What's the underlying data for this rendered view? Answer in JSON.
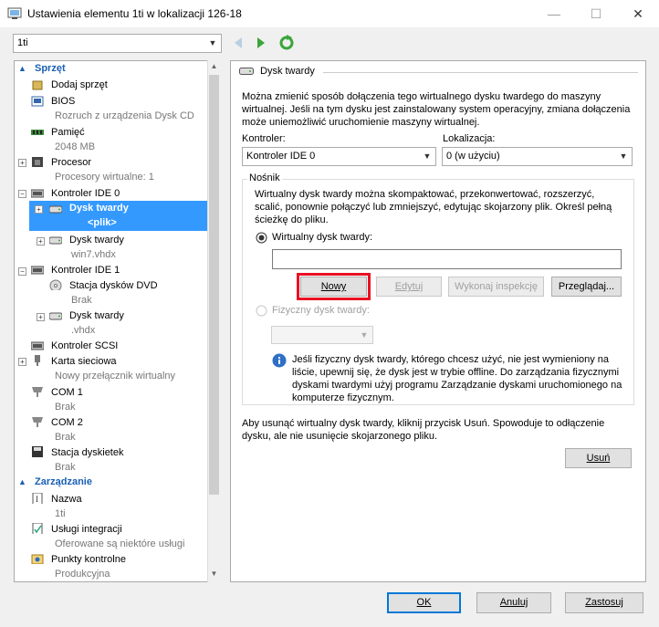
{
  "window": {
    "title": "Ustawienia elementu 1ti w lokalizacji 126-18"
  },
  "vm_selector": {
    "value": "1ti"
  },
  "tree": {
    "hardware_header": "Sprzęt",
    "add_hardware": "Dodaj sprzęt",
    "bios": "BIOS",
    "bios_sub": "Rozruch z urządzenia Dysk CD",
    "memory": "Pamięć",
    "memory_sub": "2048 MB",
    "processor": "Procesor",
    "processor_sub": "Procesory wirtualne: 1",
    "ide0": "Kontroler IDE 0",
    "hdd_selected": "Dysk twardy",
    "hdd_selected_sub": "<plik>",
    "hdd2": "Dysk twardy",
    "hdd2_sub": "win7.vhdx",
    "ide1": "Kontroler IDE 1",
    "dvd": "Stacja dysków DVD",
    "dvd_sub": "Brak",
    "hdd3": "Dysk twardy",
    "hdd3_sub": ".vhdx",
    "scsi": "Kontroler SCSI",
    "nic": "Karta sieciowa",
    "nic_sub": "Nowy przełącznik wirtualny",
    "com1": "COM 1",
    "com1_sub": "Brak",
    "com2": "COM 2",
    "com2_sub": "Brak",
    "floppy": "Stacja dyskietek",
    "floppy_sub": "Brak",
    "management_header": "Zarządzanie",
    "name": "Nazwa",
    "name_sub": "1ti",
    "integration": "Usługi integracji",
    "integration_sub": "Oferowane są niektóre usługi",
    "checkpoints": "Punkty kontrolne",
    "checkpoints_sub": "Produkcyjna"
  },
  "panel": {
    "title": "Dysk twardy",
    "desc1": "Można zmienić sposób dołączenia tego wirtualnego dysku twardego do maszyny",
    "desc2": "wirtualnej. Jeśli na tym dysku jest zainstalowany system operacyjny, zmiana dołączenia",
    "desc3": "może uniemożliwić uruchomienie maszyny wirtualnej.",
    "controller_label": "Kontroler:",
    "controller_value": "Kontroler IDE 0",
    "location_label": "Lokalizacja:",
    "location_value": "0 (w użyciu)",
    "media_label": "Nośnik",
    "media_desc1": "Wirtualny dysk twardy można skompaktować, przekonwertować, rozszerzyć,",
    "media_desc2": "scalić, ponownie połączyć lub zmniejszyć, edytując skojarzony plik. Określ pełną",
    "media_desc3": "ścieżkę do pliku.",
    "virtual_hdd_label": "Wirtualny dysk twardy:",
    "path_value": "",
    "new_btn": "Nowy",
    "edit_btn": "Edytuj",
    "inspect_btn": "Wykonaj inspekcję",
    "browse_btn": "Przeglądaj...",
    "physical_hdd_label": "Fizyczny dysk twardy:",
    "physical_value": "",
    "info1": "Jeśli fizyczny dysk twardy, którego chcesz użyć, nie jest wymieniony na",
    "info2": "liście, upewnij się, że dysk jest w trybie offline. Do zarządzania fizycznymi",
    "info3": "dyskami twardymi użyj programu Zarządzanie dyskami uruchomionego na",
    "info4": "komputerze fizycznym.",
    "remove_desc1": "Aby usunąć wirtualny dysk twardy, kliknij przycisk Usuń. Spowoduje to odłączenie",
    "remove_desc2": "dysku, ale nie usunięcie skojarzonego pliku.",
    "remove_btn": "Usuń"
  },
  "footer": {
    "ok": "OK",
    "cancel": "Anuluj",
    "apply": "Zastosuj"
  },
  "colors": {
    "selection": "#3399ff",
    "highlight_border": "#e81123",
    "accent": "#1a5fb4"
  }
}
